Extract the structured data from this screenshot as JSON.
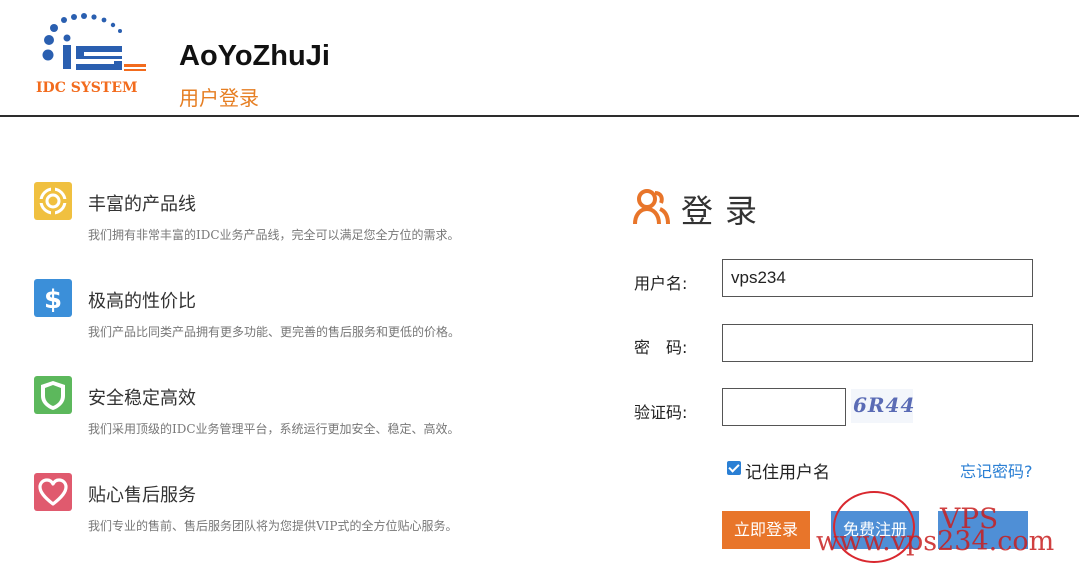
{
  "header": {
    "logo_text": "IDC SYSTEM",
    "brand_name": "AoYoZhuJi",
    "subtitle": "用户登录"
  },
  "features": [
    {
      "icon": "target-icon",
      "title": "丰富的产品线",
      "desc": "我们拥有非常丰富的IDC业务产品线，完全可以满足您全方位的需求。",
      "color": "#f0c040"
    },
    {
      "icon": "dollar-icon",
      "title": "极高的性价比",
      "desc": "我们产品比同类产品拥有更多功能、更完善的售后服务和更低的价格。",
      "color": "#3b8fd9"
    },
    {
      "icon": "shield-icon",
      "title": "安全稳定高效",
      "desc": "我们采用顶级的IDC业务管理平台，系统运行更加安全、稳定、高效。",
      "color": "#5cb85c"
    },
    {
      "icon": "heart-icon",
      "title": "贴心售后服务",
      "desc": "我们专业的售前、售后服务团队将为您提供VIP式的全方位贴心服务。",
      "color": "#e05a6e"
    }
  ],
  "login": {
    "title": "登录",
    "username_label": "用户名:",
    "username_value": "vps234",
    "password_label": "密　码:",
    "password_value": "",
    "captcha_label": "验证码:",
    "captcha_value": "",
    "captcha_text": "6R44",
    "remember_label": "记住用户名",
    "remember_checked": true,
    "forgot_label": "忘记密码?",
    "login_button": "立即登录",
    "register_button": "免费注册",
    "third_button": ""
  },
  "watermark": {
    "line1": "VPS",
    "line2": "www.vps234.com"
  },
  "colors": {
    "accent_orange": "#e8752a",
    "accent_blue": "#4f8fd6",
    "link_blue": "#2a7fd4"
  }
}
